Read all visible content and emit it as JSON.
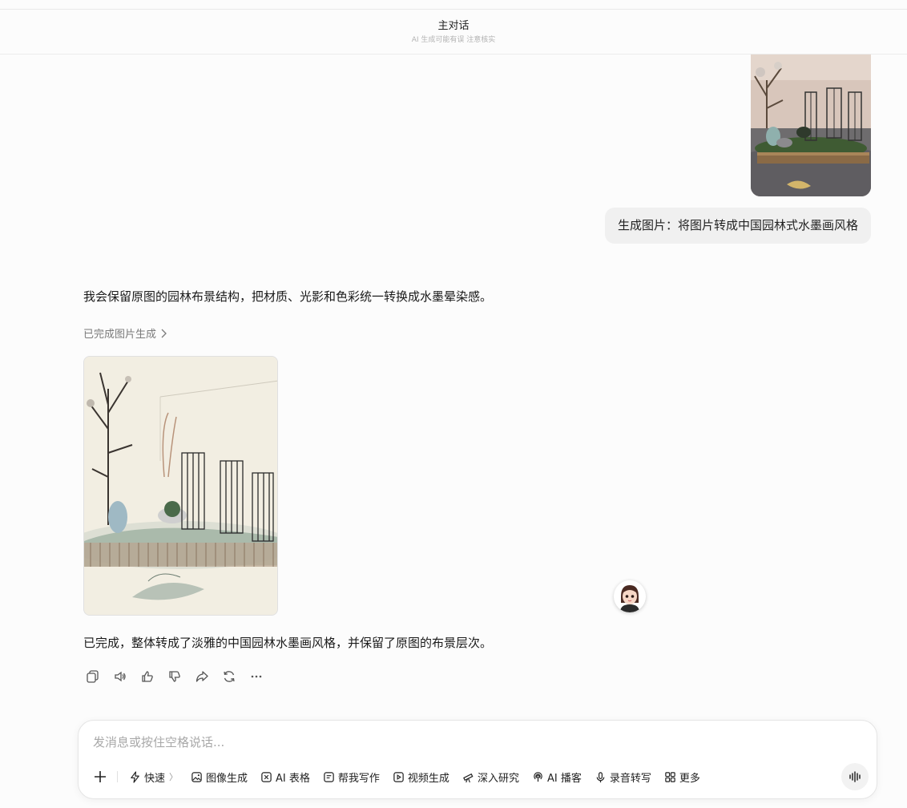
{
  "header": {
    "title": "主对话",
    "subtitle": "AI 生成可能有误 注意核实"
  },
  "user_message": {
    "text": "生成图片：将图片转成中国园林式水墨画风格"
  },
  "assistant": {
    "intro": "我会保留原图的园林布景结构，把材质、光影和色彩统一转换成水墨晕染感。",
    "status_link": "已完成图片生成",
    "final": "已完成，整体转成了淡雅的中国园林水墨画风格，并保留了原图的布景层次。"
  },
  "message_actions": [
    "copy-icon",
    "speaker-icon",
    "thumbs-up-icon",
    "thumbs-down-icon",
    "share-icon",
    "regenerate-icon",
    "more-icon"
  ],
  "composer": {
    "placeholder": "发消息或按住空格说话...",
    "tools": [
      {
        "label": "快速",
        "icon": "lightning-icon",
        "caret": "〉"
      },
      {
        "label": "图像生成",
        "icon": "image-icon"
      },
      {
        "label": "AI 表格",
        "icon": "table-icon"
      },
      {
        "label": "帮我写作",
        "icon": "pen-icon"
      },
      {
        "label": "视频生成",
        "icon": "video-icon"
      },
      {
        "label": "深入研究",
        "icon": "telescope-icon"
      },
      {
        "label": "AI 播客",
        "icon": "podcast-icon"
      },
      {
        "label": "录音转写",
        "icon": "mic-icon"
      },
      {
        "label": "更多",
        "icon": "grid-icon"
      }
    ]
  }
}
